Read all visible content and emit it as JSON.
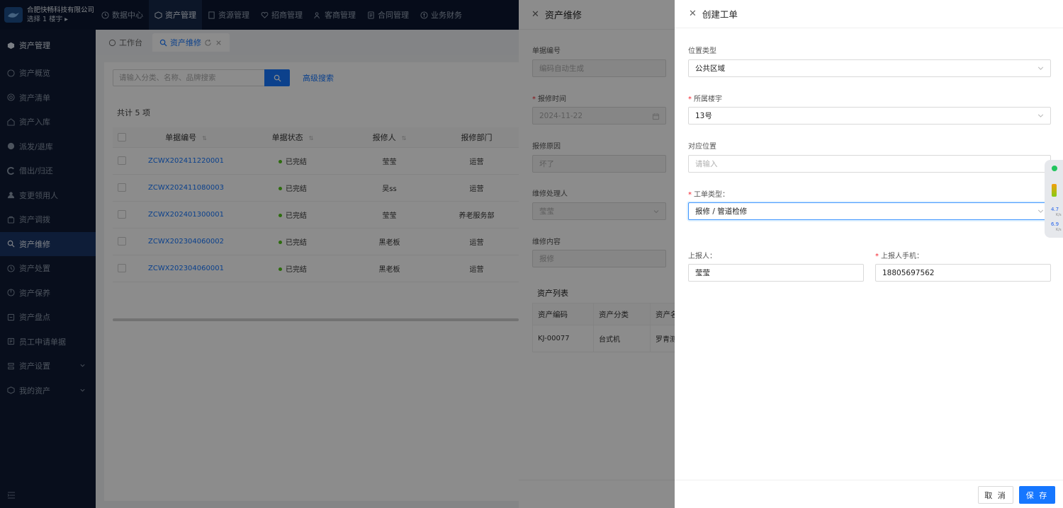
{
  "company": {
    "name": "合肥快畅科技有限公司",
    "building_select": "选择 1 楼宇 ▸"
  },
  "topnav": [
    {
      "label": "数据中心",
      "active": false
    },
    {
      "label": "资产管理",
      "active": true
    },
    {
      "label": "资源管理",
      "active": false
    },
    {
      "label": "招商管理",
      "active": false
    },
    {
      "label": "客商管理",
      "active": false
    },
    {
      "label": "合同管理",
      "active": false
    },
    {
      "label": "业务财务",
      "active": false
    }
  ],
  "sidebar": {
    "header": "资产管理",
    "items": [
      {
        "label": "资产概览",
        "icon": "dashboard-icon"
      },
      {
        "label": "资产清单",
        "icon": "list-icon"
      },
      {
        "label": "资产入库",
        "icon": "inbound-icon"
      },
      {
        "label": "派发/退库",
        "icon": "dispatch-icon"
      },
      {
        "label": "借出/归还",
        "icon": "lend-icon"
      },
      {
        "label": "变更领用人",
        "icon": "user-icon"
      },
      {
        "label": "资产调拨",
        "icon": "transfer-icon"
      },
      {
        "label": "资产维修",
        "icon": "search-icon",
        "active": true
      },
      {
        "label": "资产处置",
        "icon": "dispose-icon"
      },
      {
        "label": "资产保养",
        "icon": "maintain-icon"
      },
      {
        "label": "资产盘点",
        "icon": "inventory-icon"
      },
      {
        "label": "员工申请单据",
        "icon": "document-icon"
      },
      {
        "label": "资产设置",
        "icon": "settings-icon",
        "expandable": true
      },
      {
        "label": "我的资产",
        "icon": "box-icon",
        "expandable": true
      }
    ]
  },
  "tabs": [
    {
      "label": "工作台",
      "active": false
    },
    {
      "label": "资产维修",
      "active": true
    }
  ],
  "search": {
    "placeholder": "请输入分类、名称、品牌搜索",
    "advanced": "高级搜索"
  },
  "list": {
    "total": "共计 5 项",
    "columns": [
      "单据编号",
      "单据状态",
      "报修人",
      "报修部门"
    ],
    "rows": [
      {
        "code": "ZCWX202411220001",
        "status": "已完结",
        "reporter": "莹莹",
        "dept": "运营"
      },
      {
        "code": "ZCWX202411080003",
        "status": "已完结",
        "reporter": "吴ss",
        "dept": "运营"
      },
      {
        "code": "ZCWX202401300001",
        "status": "已完结",
        "reporter": "莹莹",
        "dept": "养老服务部"
      },
      {
        "code": "ZCWX202304060002",
        "status": "已完结",
        "reporter": "黑老板",
        "dept": "运营"
      },
      {
        "code": "ZCWX202304060001",
        "status": "已完结",
        "reporter": "黑老板",
        "dept": "运营"
      }
    ]
  },
  "repair_drawer": {
    "title": "资产维修",
    "fields": [
      {
        "label": "单据编号",
        "required": false,
        "value": "编码自动生成"
      },
      {
        "label": "报修时间",
        "required": true,
        "value": "2024-11-22"
      },
      {
        "label": "报修原因",
        "required": false,
        "value": "坏了"
      },
      {
        "label": "维修处理人",
        "required": false,
        "value": "莹莹"
      },
      {
        "label": "维修内容",
        "required": false,
        "value": "报修"
      }
    ],
    "asset_list_title": "资产列表",
    "asset_columns": [
      "资产编码",
      "资产分类",
      "资产名称"
    ],
    "asset_rows": [
      {
        "code": "KJ-00077",
        "category": "台式机",
        "name": "罗青测"
      }
    ]
  },
  "workorder_drawer": {
    "title": "创建工单",
    "location_type": {
      "label": "位置类型",
      "value": "公共区域"
    },
    "building": {
      "label": "所属楼宇",
      "required": true,
      "value": "13号"
    },
    "location": {
      "label": "对应位置",
      "placeholder": "请输入",
      "value": ""
    },
    "order_type": {
      "label": "工单类型：",
      "required": true,
      "value": "报修 / 管道检修"
    },
    "reporter": {
      "label": "上报人：",
      "value": "莹莹"
    },
    "phone": {
      "label": "上报人手机：",
      "required": true,
      "value": "18805697562"
    },
    "cancel": "取 消",
    "save": "保 存"
  },
  "float_widget": {
    "up": "4.7",
    "down": "6.9",
    "unit": "K/s"
  }
}
